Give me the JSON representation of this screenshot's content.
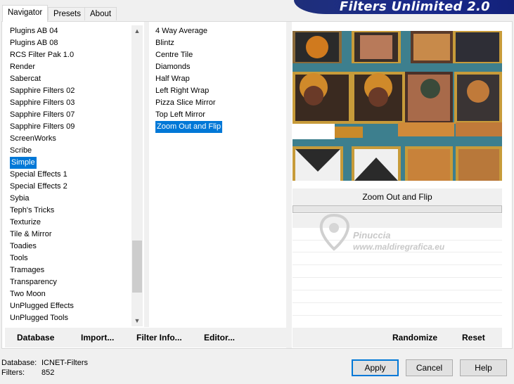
{
  "tabs": [
    {
      "label": "Navigator"
    },
    {
      "label": "Presets"
    },
    {
      "label": "About"
    }
  ],
  "banner_title": "Filters Unlimited 2.0",
  "categories": {
    "items": [
      "Plugins AB 04",
      "Plugins AB 08",
      "RCS Filter Pak 1.0",
      "Render",
      "Sabercat",
      "Sapphire Filters 02",
      "Sapphire Filters 03",
      "Sapphire Filters 07",
      "Sapphire Filters 09",
      "ScreenWorks",
      "Scribe",
      "Simple",
      "Special Effects 1",
      "Special Effects 2",
      "Sybia",
      "Teph's Tricks",
      "Texturize",
      "Tile & Mirror",
      "Toadies",
      "Tools",
      "Tramages",
      "Transparency",
      "Two Moon",
      "UnPlugged Effects",
      "UnPlugged Tools"
    ],
    "selected": "Simple"
  },
  "filters": {
    "items": [
      "4 Way Average",
      "Blintz",
      "Centre Tile",
      "Diamonds",
      "Half Wrap",
      "Left Right Wrap",
      "Pizza Slice Mirror",
      "Top Left Mirror",
      "Zoom Out and Flip"
    ],
    "selected": "Zoom Out and Flip"
  },
  "left_buttons": {
    "database": "Database",
    "import": "Import...",
    "filter_info": "Filter Info...",
    "editor": "Editor..."
  },
  "preview": {
    "filter_name": "Zoom Out and Flip"
  },
  "watermark": {
    "line1": "Pinuccia",
    "line2": "www.maldiregrafica.eu"
  },
  "right_buttons": {
    "randomize": "Randomize",
    "reset": "Reset"
  },
  "status": {
    "database_label": "Database:",
    "database_value": "ICNET-Filters",
    "filters_label": "Filters:",
    "filters_value": "852"
  },
  "dialog_buttons": {
    "apply": "Apply",
    "cancel": "Cancel",
    "help": "Help"
  },
  "colors": {
    "selection": "#0078d7",
    "banner": "#1a2a8c",
    "preview_bg": "#3d7f8e"
  }
}
